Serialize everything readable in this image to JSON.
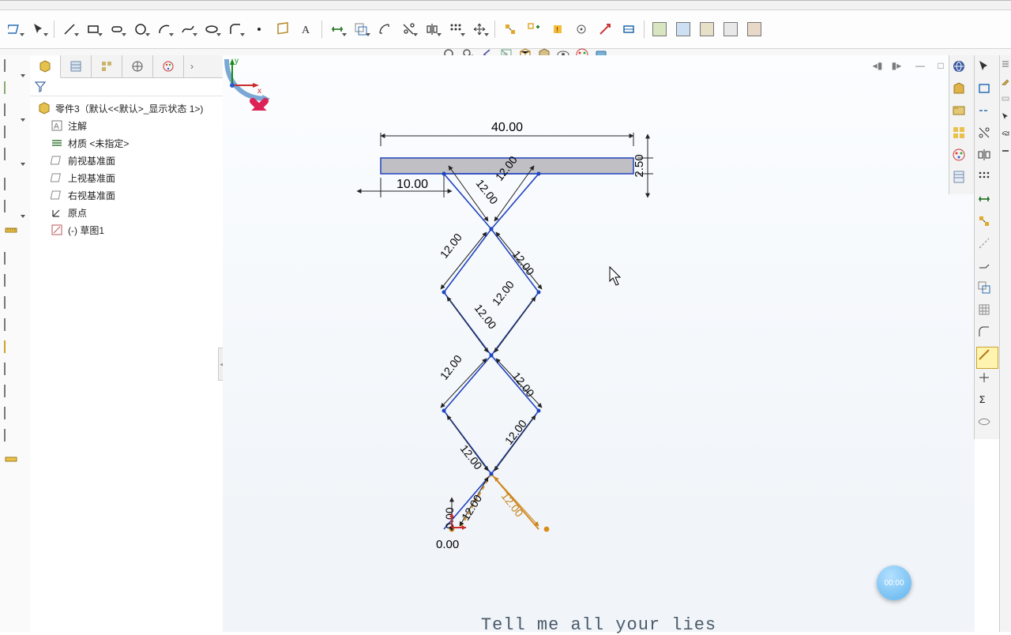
{
  "part": {
    "name": "零件3（默认<<默认>_显示状态 1>)",
    "nodes": {
      "annotations": "注解",
      "material": "材质 <未指定>",
      "front_plane": "前视基准面",
      "top_plane": "上视基准面",
      "right_plane": "右视基准面",
      "origin": "原点",
      "sketch1": "(-) 草图1"
    }
  },
  "dims": {
    "d40": "40.00",
    "d10": "10.00",
    "d2_5": "2.50",
    "d0": "0.00",
    "seg": "12.00"
  },
  "triad": {
    "x": "x",
    "y": "y"
  },
  "timer": "00:00",
  "subtitle": "Tell me all your lies"
}
